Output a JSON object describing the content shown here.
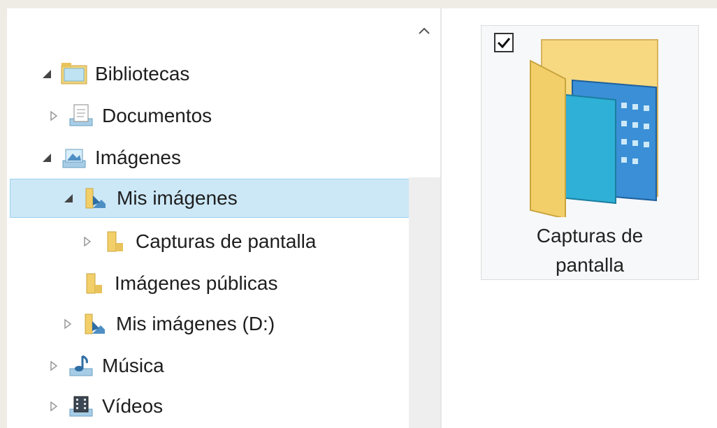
{
  "nav": {
    "items": [
      {
        "label": "Bibliotecas",
        "icon": "libraries-icon",
        "expander": "expanded"
      },
      {
        "label": "Documentos",
        "icon": "documents-library-icon",
        "expander": "collapsed"
      },
      {
        "label": "Imágenes",
        "icon": "pictures-library-icon",
        "expander": "expanded"
      },
      {
        "label": "Mis imágenes",
        "icon": "my-pictures-folder-icon",
        "expander": "expanded",
        "selected": true
      },
      {
        "label": "Capturas de pantalla",
        "icon": "folder-icon",
        "expander": "collapsed"
      },
      {
        "label": "Imágenes públicas",
        "icon": "folder-icon",
        "expander": "none"
      },
      {
        "label": "Mis imágenes (D:)",
        "icon": "my-pictures-folder-icon",
        "expander": "collapsed"
      },
      {
        "label": "Música",
        "icon": "music-library-icon",
        "expander": "collapsed"
      },
      {
        "label": "Vídeos",
        "icon": "videos-library-icon",
        "expander": "collapsed"
      }
    ]
  },
  "content": {
    "tile": {
      "label_line1": "Capturas de",
      "label_line2": "pantalla",
      "checked": true,
      "icon": "screenshots-folder-icon"
    }
  },
  "colors": {
    "selection_bg": "#cce8f7",
    "selection_border": "#99d1ef",
    "folder_yellow": "#f3cf6a"
  }
}
